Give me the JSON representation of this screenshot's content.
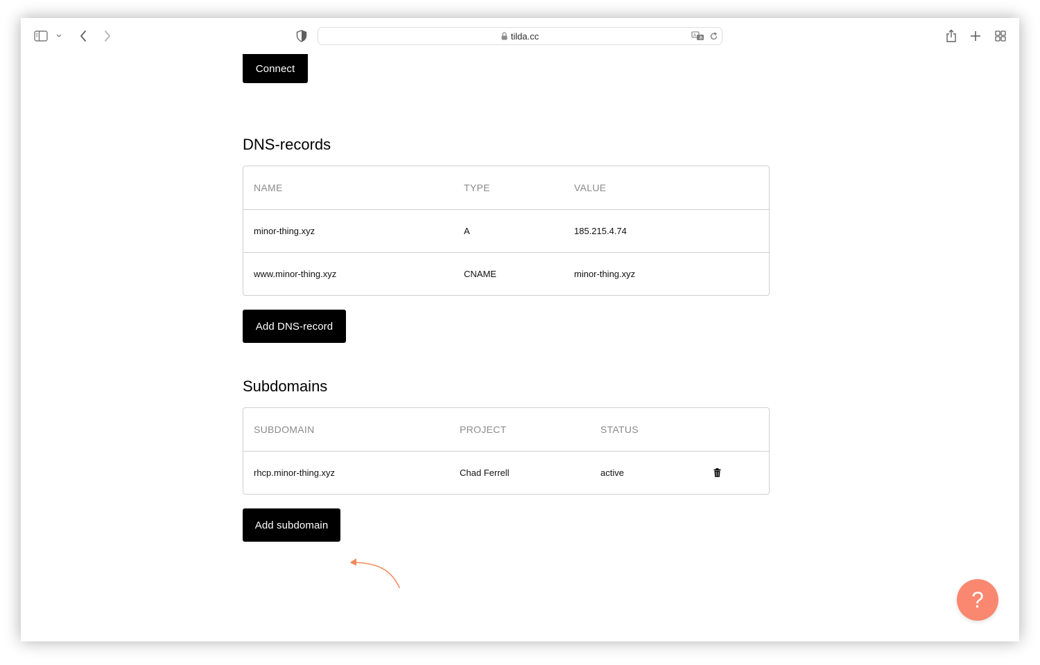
{
  "browser": {
    "url": "tilda.cc"
  },
  "page": {
    "connect_label": "Connect",
    "dns": {
      "title": "DNS-records",
      "columns": [
        "NAME",
        "TYPE",
        "VALUE"
      ],
      "rows": [
        [
          "minor-thing.xyz",
          "A",
          "185.215.4.74"
        ],
        [
          "www.minor-thing.xyz",
          "CNAME",
          "minor-thing.xyz"
        ]
      ],
      "add_label": "Add DNS-record"
    },
    "subdomains": {
      "title": "Subdomains",
      "columns": [
        "SUBDOMAIN",
        "PROJECT",
        "STATUS"
      ],
      "rows": [
        [
          "rhcp.minor-thing.xyz",
          "Chad Ferrell",
          "active"
        ]
      ],
      "add_label": "Add subdomain"
    },
    "help_label": "?"
  },
  "colors": {
    "button": "#000000",
    "help": "#fa8870",
    "annotation_arrow": "#f2885a"
  },
  "icons": [
    "sidebar-icon",
    "chevron-down-icon",
    "back-icon",
    "forward-icon",
    "shield-icon",
    "lock-icon",
    "translate-icon",
    "reload-icon",
    "share-icon",
    "plus-icon",
    "tabs-grid-icon",
    "trash-icon",
    "question-icon"
  ]
}
